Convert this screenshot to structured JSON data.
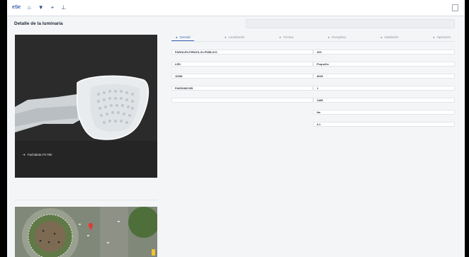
{
  "page": {
    "title": "Detalle de la luminaria"
  },
  "photo": {
    "caption": "Fachaleta Fri-Tek"
  },
  "tabs": [
    "General",
    "Localización",
    "Técnica",
    "Energética",
    "Instalación",
    "Operación"
  ],
  "left_fields": [
    {
      "value": "FAROLES-PIRATA-01-PÚBLICO"
    },
    {
      "value": "LED"
    },
    {
      "value": "100W"
    },
    {
      "value": "FA05168COB"
    },
    {
      "value": ""
    }
  ],
  "right_fields": [
    {
      "value": "100"
    },
    {
      "value": "Pequeño"
    },
    {
      "value": "4000"
    },
    {
      "value": "1"
    },
    {
      "value": "1480"
    },
    {
      "value": "No"
    },
    {
      "value": "4.1"
    }
  ],
  "colors": {
    "accent": "#3c63b5",
    "map_pin": "#e53935"
  }
}
